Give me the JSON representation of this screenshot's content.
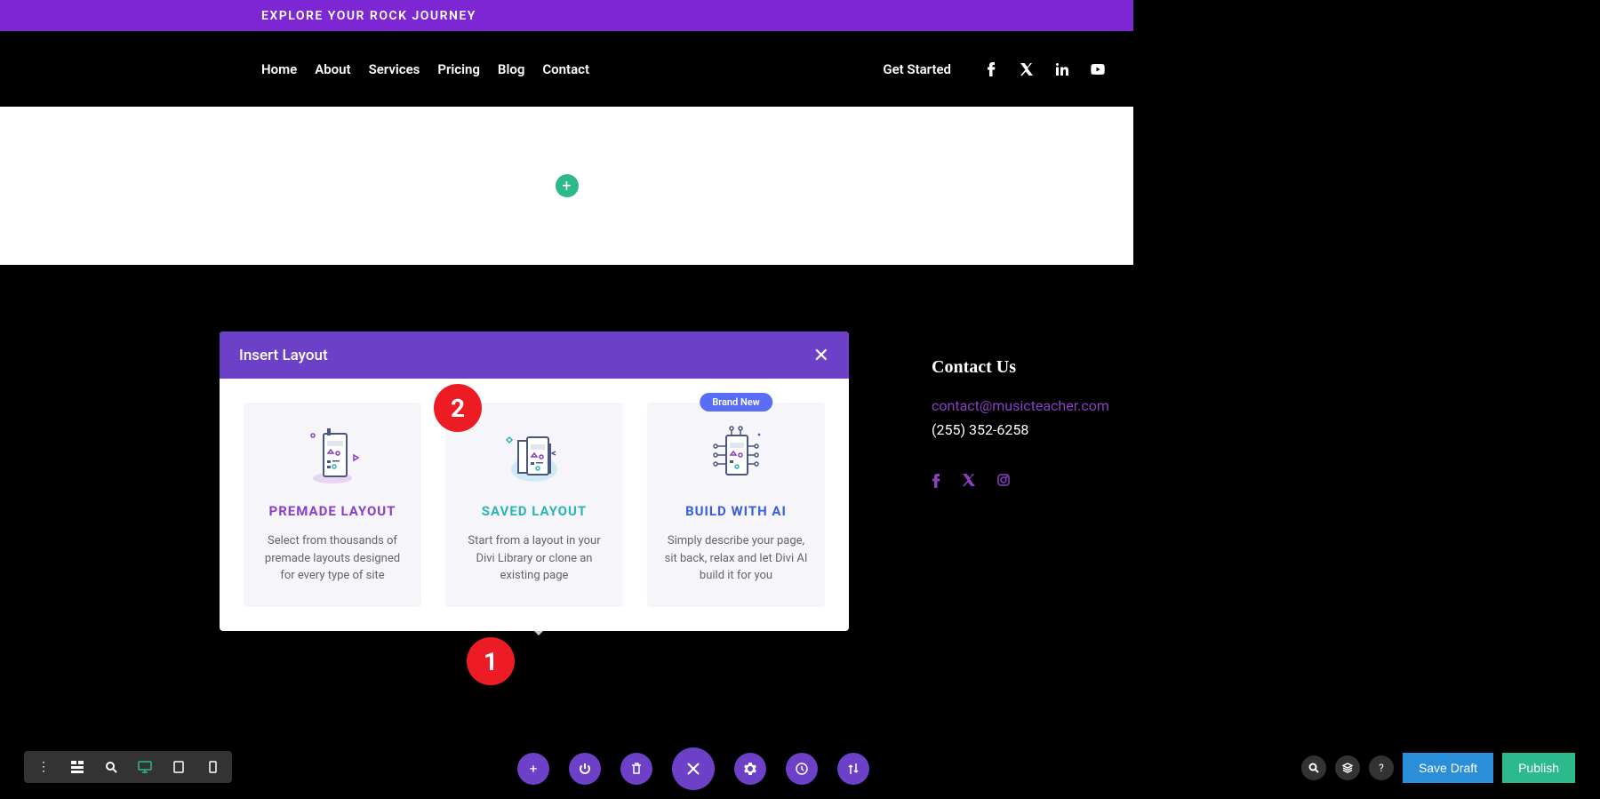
{
  "banner": {
    "text": "EXPLORE YOUR ROCK JOURNEY"
  },
  "nav": {
    "items": [
      "Home",
      "About",
      "Services",
      "Pricing",
      "Blog",
      "Contact"
    ],
    "cta": "Get Started",
    "socials": [
      "facebook-icon",
      "x-icon",
      "linkedin-icon",
      "youtube-icon"
    ]
  },
  "contact": {
    "title": "Contact Us",
    "email": "contact@musicteacher.com",
    "phone": "(255) 352-6258",
    "socials": [
      "facebook-icon",
      "x-icon",
      "instagram-icon"
    ]
  },
  "modal": {
    "title": "Insert Layout",
    "cards": [
      {
        "title": "PREMADE LAYOUT",
        "desc": "Select from thousands of premade layouts designed for every type of site"
      },
      {
        "title": "SAVED LAYOUT",
        "desc": "Start from a layout in your Divi Library or clone an existing page"
      },
      {
        "title": "BUILD WITH AI",
        "desc": "Simply describe your page, sit back, relax and let Divi AI build it for you",
        "badge": "Brand New"
      }
    ]
  },
  "steps": {
    "one": "1",
    "two": "2"
  },
  "bottom": {
    "save_draft": "Save Draft",
    "publish": "Publish"
  }
}
